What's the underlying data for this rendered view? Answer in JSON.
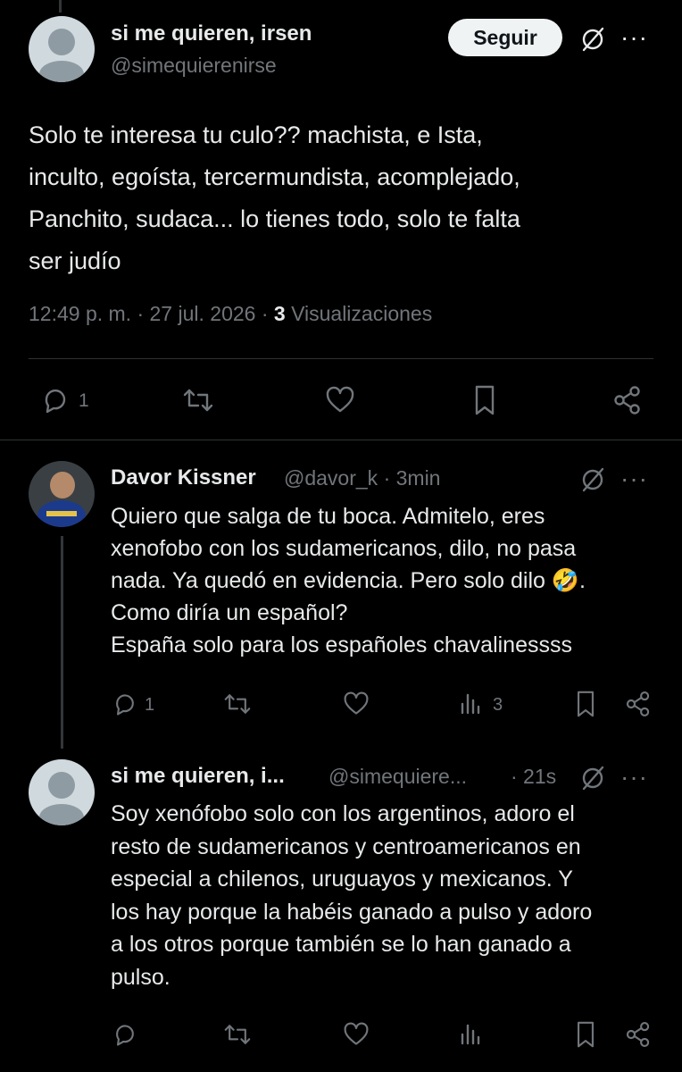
{
  "main_tweet": {
    "display_name": "si me quieren, irsen",
    "handle": "@simequierenirse",
    "follow_label": "Seguir",
    "more_label": "···",
    "text_lines": [
      "Solo te interesa tu culo?? machista, e Ista,",
      "inculto, egoísta, tercermundista, acomplejado,",
      "Panchito, sudaca... lo tienes todo, solo te falta",
      "ser judío"
    ],
    "timestamp": "12:49 p. m. · 27 jul. 2026 · ",
    "views_count": "3",
    "views_label": " Visualizaciones",
    "reply_count": "1"
  },
  "reply1": {
    "display_name": "Davor Kissner",
    "meta": "@davor_k · 3min",
    "more_label": "···",
    "text_lines": [
      "Quiero que salga de tu boca. Admitelo, eres",
      "xenofobo con los sudamericanos, dilo, no pasa",
      "nada. Ya quedó en evidencia. Pero solo dilo 🤣.",
      "Como diría un español?",
      "España solo para los españoles chavalinessss"
    ],
    "reply_count": "1",
    "views_count": "3"
  },
  "reply2": {
    "display_name": "si me quieren, i...",
    "handle": "@simequiere...",
    "time": "· 21s",
    "more_label": "···",
    "text_lines": [
      "Soy xenófobo solo con los argentinos, adoro el",
      "resto de sudamericanos y centroamericanos en",
      "especial a chilenos, uruguayos y mexicanos. Y",
      "los hay porque la habéis ganado a pulso y adoro",
      "a los otros porque también se lo han ganado a",
      "pulso."
    ]
  },
  "icons": [
    "reply-icon",
    "retweet-icon",
    "like-icon",
    "bookmark-icon",
    "share-icon",
    "views-icon",
    "grok-icon",
    "more-icon"
  ],
  "colors": {
    "background": "#000000",
    "text": "#e7e9ea",
    "muted": "#71767b",
    "divider": "#2f3336",
    "follow_bg": "#eff3f4"
  }
}
